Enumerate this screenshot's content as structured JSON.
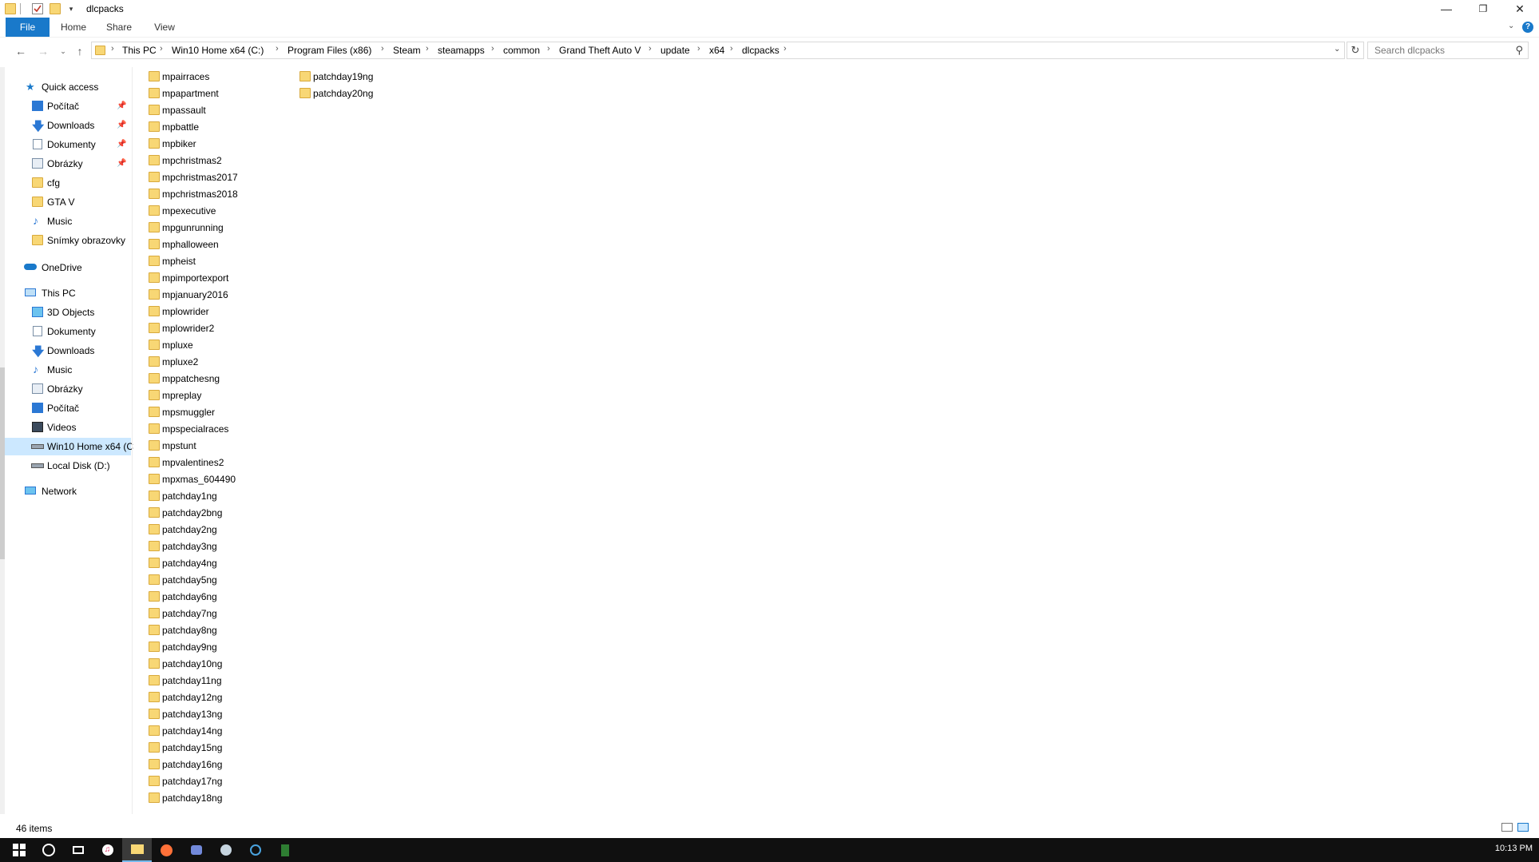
{
  "window": {
    "title": "dlcpacks",
    "minimize_icon": "minimize-icon",
    "maximize_icon": "restore-icon",
    "close_icon": "close-icon"
  },
  "ribbon": {
    "tabs": [
      "File",
      "Home",
      "Share",
      "View"
    ]
  },
  "address": {
    "crumbs": [
      "This PC",
      "Win10 Home x64 (C:)",
      "Program Files (x86)",
      "Steam",
      "steamapps",
      "common",
      "Grand Theft Auto V",
      "update",
      "x64",
      "dlcpacks"
    ]
  },
  "search": {
    "placeholder": "Search dlcpacks"
  },
  "nav": {
    "quick_access": "Quick access",
    "quick_items": [
      {
        "label": "Počítač",
        "icon": "desktop-icon",
        "pinned": true
      },
      {
        "label": "Downloads",
        "icon": "download-icon",
        "pinned": true
      },
      {
        "label": "Dokumenty",
        "icon": "documents-icon",
        "pinned": true
      },
      {
        "label": "Obrázky",
        "icon": "pictures-icon",
        "pinned": true
      },
      {
        "label": "cfg",
        "icon": "folder-icon",
        "pinned": false
      },
      {
        "label": "GTA V",
        "icon": "folder-icon",
        "pinned": false
      },
      {
        "label": "Music",
        "icon": "music-icon",
        "pinned": false
      },
      {
        "label": "Snímky obrazovky",
        "icon": "folder-icon",
        "pinned": false
      }
    ],
    "onedrive": "OneDrive",
    "this_pc": "This PC",
    "pc_items": [
      {
        "label": "3D Objects",
        "icon": "3d-objects-icon"
      },
      {
        "label": "Dokumenty",
        "icon": "documents-icon"
      },
      {
        "label": "Downloads",
        "icon": "download-icon"
      },
      {
        "label": "Music",
        "icon": "music-icon"
      },
      {
        "label": "Obrázky",
        "icon": "pictures-icon"
      },
      {
        "label": "Počítač",
        "icon": "desktop-icon"
      },
      {
        "label": "Videos",
        "icon": "videos-icon"
      },
      {
        "label": "Win10 Home x64 (C",
        "icon": "drive-icon",
        "selected": true
      },
      {
        "label": "Local Disk (D:)",
        "icon": "drive-icon"
      }
    ],
    "network": "Network"
  },
  "files": {
    "column1": [
      "mpairraces",
      "mpapartment",
      "mpassault",
      "mpbattle",
      "mpbiker",
      "mpchristmas2",
      "mpchristmas2017",
      "mpchristmas2018",
      "mpexecutive",
      "mpgunrunning",
      "mphalloween",
      "mpheist",
      "mpimportexport",
      "mpjanuary2016",
      "mplowrider",
      "mplowrider2",
      "mpluxe",
      "mpluxe2",
      "mppatchesng",
      "mpreplay",
      "mpsmuggler",
      "mpspecialraces",
      "mpstunt",
      "mpvalentines2",
      "mpxmas_604490",
      "patchday1ng",
      "patchday2bng",
      "patchday2ng",
      "patchday3ng",
      "patchday4ng",
      "patchday5ng",
      "patchday6ng",
      "patchday7ng",
      "patchday8ng",
      "patchday9ng",
      "patchday10ng",
      "patchday11ng",
      "patchday12ng",
      "patchday13ng",
      "patchday14ng",
      "patchday15ng",
      "patchday16ng",
      "patchday17ng",
      "patchday18ng"
    ],
    "column2": [
      "patchday19ng",
      "patchday20ng"
    ]
  },
  "status": {
    "item_count": "46 items"
  },
  "taskbar": {
    "icons": [
      "windows-start-icon",
      "cortana-icon",
      "task-view-icon",
      "itunes-icon",
      "file-explorer-icon",
      "firefox-icon",
      "discord-icon",
      "steam-icon",
      "app-icon",
      "gta-icon"
    ],
    "time": "10:13 PM"
  },
  "colors": {
    "accent": "#1979ca",
    "folder": "#f8d775",
    "selection": "#cce8ff",
    "taskbar": "#101010"
  }
}
